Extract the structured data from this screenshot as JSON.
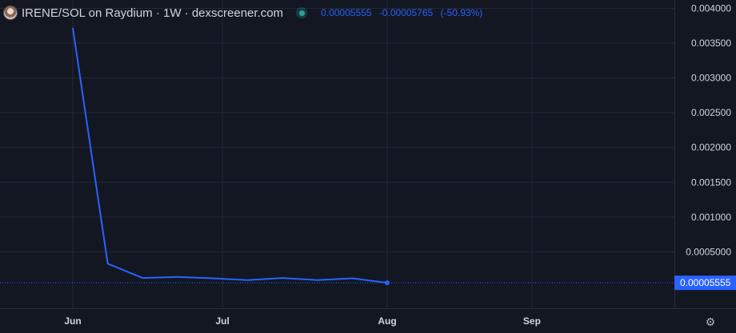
{
  "header": {
    "title": "IRENE/SOL on Raydium · 1W · dexscreener.com",
    "last_value": "0.00005555",
    "change": "-0.00005765",
    "change_pct": "(-50.93%)"
  },
  "price_label": "0.00005555",
  "colors": {
    "background": "#131722",
    "line": "#2962ff",
    "grid": "#232836",
    "axis_text": "#d1d4dc",
    "status": "#26a69a"
  },
  "chart_data": {
    "type": "line",
    "x": [
      "2023-06-01",
      "2023-06-08",
      "2023-06-15",
      "2023-06-22",
      "2023-06-29",
      "2023-07-06",
      "2023-07-13",
      "2023-07-20",
      "2023-07-27",
      "2023-08-03"
    ],
    "series": [
      {
        "values": [
          0.00372,
          0.00033,
          0.000125,
          0.00014,
          0.00012,
          9.5e-05,
          0.000125,
          9.5e-05,
          0.00012,
          5.555e-05
        ]
      }
    ],
    "x_ticks": [
      {
        "label": "Jun",
        "date": "2023-06-01"
      },
      {
        "label": "Jul",
        "date": "2023-07-01"
      },
      {
        "label": "Aug",
        "date": "2023-08-03"
      },
      {
        "label": "Sep",
        "date": "2023-09-01"
      }
    ],
    "y_ticks": [
      "0.0005000",
      "0.001000",
      "0.001500",
      "0.002000",
      "0.002500",
      "0.003000",
      "0.003500",
      "0.004000"
    ],
    "ylim": [
      -0.00031,
      0.00412
    ],
    "grid": true,
    "last_price_line": 5.555e-05
  }
}
